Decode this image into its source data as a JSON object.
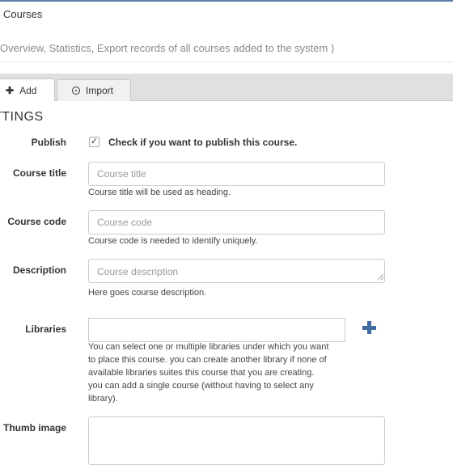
{
  "header": {
    "title": "Courses",
    "subtitle": "Overview, Statistics, Export records of all courses added to the system )"
  },
  "tabs": [
    {
      "label": "Add",
      "icon": "plus-icon",
      "active": true
    },
    {
      "label": "Import",
      "icon": "import-icon",
      "active": false
    }
  ],
  "form": {
    "section_heading": "TTINGS",
    "publish": {
      "label": "Publish",
      "checkbox_label": "Check if you want to publish this course.",
      "checked": true
    },
    "course_title": {
      "label": "Course title",
      "placeholder": "Course title",
      "help": "Course title will be used as heading."
    },
    "course_code": {
      "label": "Course code",
      "placeholder": "Course code",
      "help": "Course code is needed to identify uniquely."
    },
    "description": {
      "label": "Description",
      "placeholder": "Course description",
      "help": "Here goes course description."
    },
    "libraries": {
      "label": "Libraries",
      "value": "",
      "help_lines": [
        "You can select one or multiple libraries under which you want",
        "to place this course. you can create another library if none of",
        "available libraries suites this course that you are creating.",
        "you can add a single course (without having to select any",
        "library)."
      ]
    },
    "thumb_image": {
      "label": "Thumb image"
    }
  },
  "colors": {
    "accent": "#3f6aa2",
    "tabbar_bg": "#e0e0e0"
  }
}
